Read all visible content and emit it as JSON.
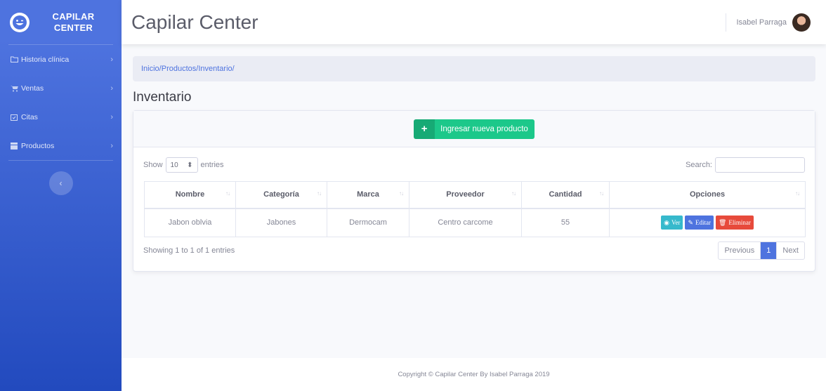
{
  "brand": {
    "line1": "CAPILAR",
    "line2": "CENTER"
  },
  "sidebar": {
    "items": [
      {
        "label": "Historia clínica",
        "icon": "folder-icon"
      },
      {
        "label": "Ventas",
        "icon": "cart-icon"
      },
      {
        "label": "Citas",
        "icon": "calendar-icon"
      },
      {
        "label": "Productos",
        "icon": "products-icon"
      }
    ],
    "toggle": "‹"
  },
  "topbar": {
    "title": "Capilar Center",
    "user": "Isabel Parraga"
  },
  "breadcrumb": "Inicio/Productos/Inventario/",
  "page_title": "Inventario",
  "card": {
    "add_button": "Ingresar nueva producto",
    "show_label": "Show",
    "show_value": "10",
    "entries_label": "entries",
    "search_label": "Search:",
    "search_value": ""
  },
  "table": {
    "headers": [
      "Nombre",
      "Categoría",
      "Marca",
      "Proveedor",
      "Cantidad",
      "Opciones"
    ],
    "rows": [
      {
        "nombre": "Jabon oblvia",
        "categoria": "Jabones",
        "marca": "Dermocam",
        "proveedor": "Centro carcome",
        "cantidad": "55"
      }
    ],
    "actions": {
      "ver": "Ver",
      "editar": "Editar",
      "eliminar": "Eliminar"
    }
  },
  "info": "Showing 1 to 1 of 1 entries",
  "pagination": {
    "previous": "Previous",
    "current": "1",
    "next": "Next"
  },
  "footer": "Copyright © Capilar Center By Isabel Parraga 2019",
  "colors": {
    "primary": "#4e73df",
    "success": "#1cc88a",
    "info": "#36b9cc",
    "danger": "#e74a3b"
  }
}
